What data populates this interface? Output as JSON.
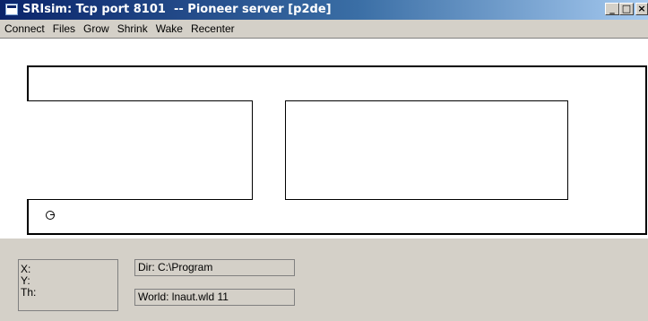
{
  "window": {
    "title": "SRIsim: Tcp port 8101  -- Pioneer server [p2de]",
    "minimize_glyph": "_",
    "maximize_glyph": "□",
    "close_glyph": "×"
  },
  "menu": {
    "items": [
      "Connect",
      "Files",
      "Grow",
      "Shrink",
      "Wake",
      "Recenter"
    ]
  },
  "status": {
    "x_label": "X:",
    "y_label": "Y:",
    "th_label": "Th:",
    "dir": "Dir: C:\\Program",
    "world": "World: lnaut.wld  11"
  },
  "colors": {
    "titlebar_start": "#0a246a",
    "titlebar_end": "#a6caf0",
    "window_bg": "#d4d0c8",
    "canvas_bg": "#ffffff"
  }
}
